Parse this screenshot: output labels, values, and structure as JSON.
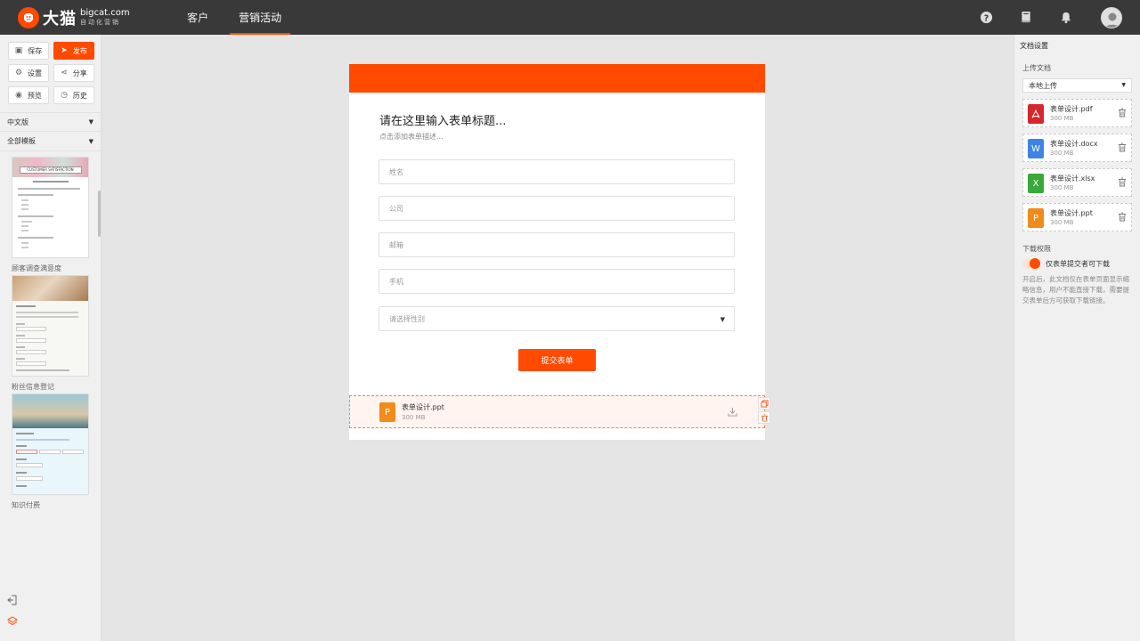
{
  "brand": {
    "name": "大猫",
    "domain": "bigcat.com",
    "tagline": "自动化营销",
    "color": "#ff4a00"
  },
  "nav": {
    "items": [
      {
        "label": "客户",
        "active": false
      },
      {
        "label": "营销活动",
        "active": true
      }
    ]
  },
  "topbar_icons": [
    "help-icon",
    "book-icon",
    "bell-icon",
    "user-avatar"
  ],
  "toolbar": {
    "save": "保存",
    "publish": "发布",
    "settings": "设置",
    "share": "分享",
    "preview": "预览",
    "history": "历史"
  },
  "sidebar": {
    "language": "中文版",
    "template_filter": "全部模板",
    "templates": [
      {
        "label": "顾客调查满意度",
        "thumb_text": "CUSTOMER SATISFACTION"
      },
      {
        "label": "粉丝信息登记"
      },
      {
        "label": "知识付费"
      }
    ]
  },
  "form": {
    "title": "请在这里输入表单标题...",
    "description": "点击添加表单描述...",
    "fields": [
      {
        "placeholder": "姓名"
      },
      {
        "placeholder": "公司"
      },
      {
        "placeholder": "邮箱"
      },
      {
        "placeholder": "手机"
      },
      {
        "placeholder": "请选择性别",
        "type": "select"
      }
    ],
    "submit": "提交表单",
    "attachment": {
      "name": "表单设计.ppt",
      "size": "300 MB",
      "icon": "P"
    }
  },
  "right_panel": {
    "title": "文档设置",
    "upload_label": "上传文档",
    "upload_source": "本地上传",
    "files": [
      {
        "name": "表单设计.pdf",
        "size": "300 MB",
        "icon": "pdf",
        "color": "#d9262c"
      },
      {
        "name": "表单设计.docx",
        "size": "300 MB",
        "icon": "W",
        "color": "#3d84e6"
      },
      {
        "name": "表单设计.xlsx",
        "size": "300 MB",
        "icon": "X",
        "color": "#3aa83a"
      },
      {
        "name": "表单设计.ppt",
        "size": "300 MB",
        "icon": "P",
        "color": "#f08c1a"
      }
    ],
    "download_label": "下载权限",
    "toggle_label": "仅表单提交者可下载",
    "toggle_on": true,
    "note": "开启后，此文档仅在表单页面显示缩略信息，用户不能直接下载，需要提交表单后方可获取下载链接。"
  }
}
